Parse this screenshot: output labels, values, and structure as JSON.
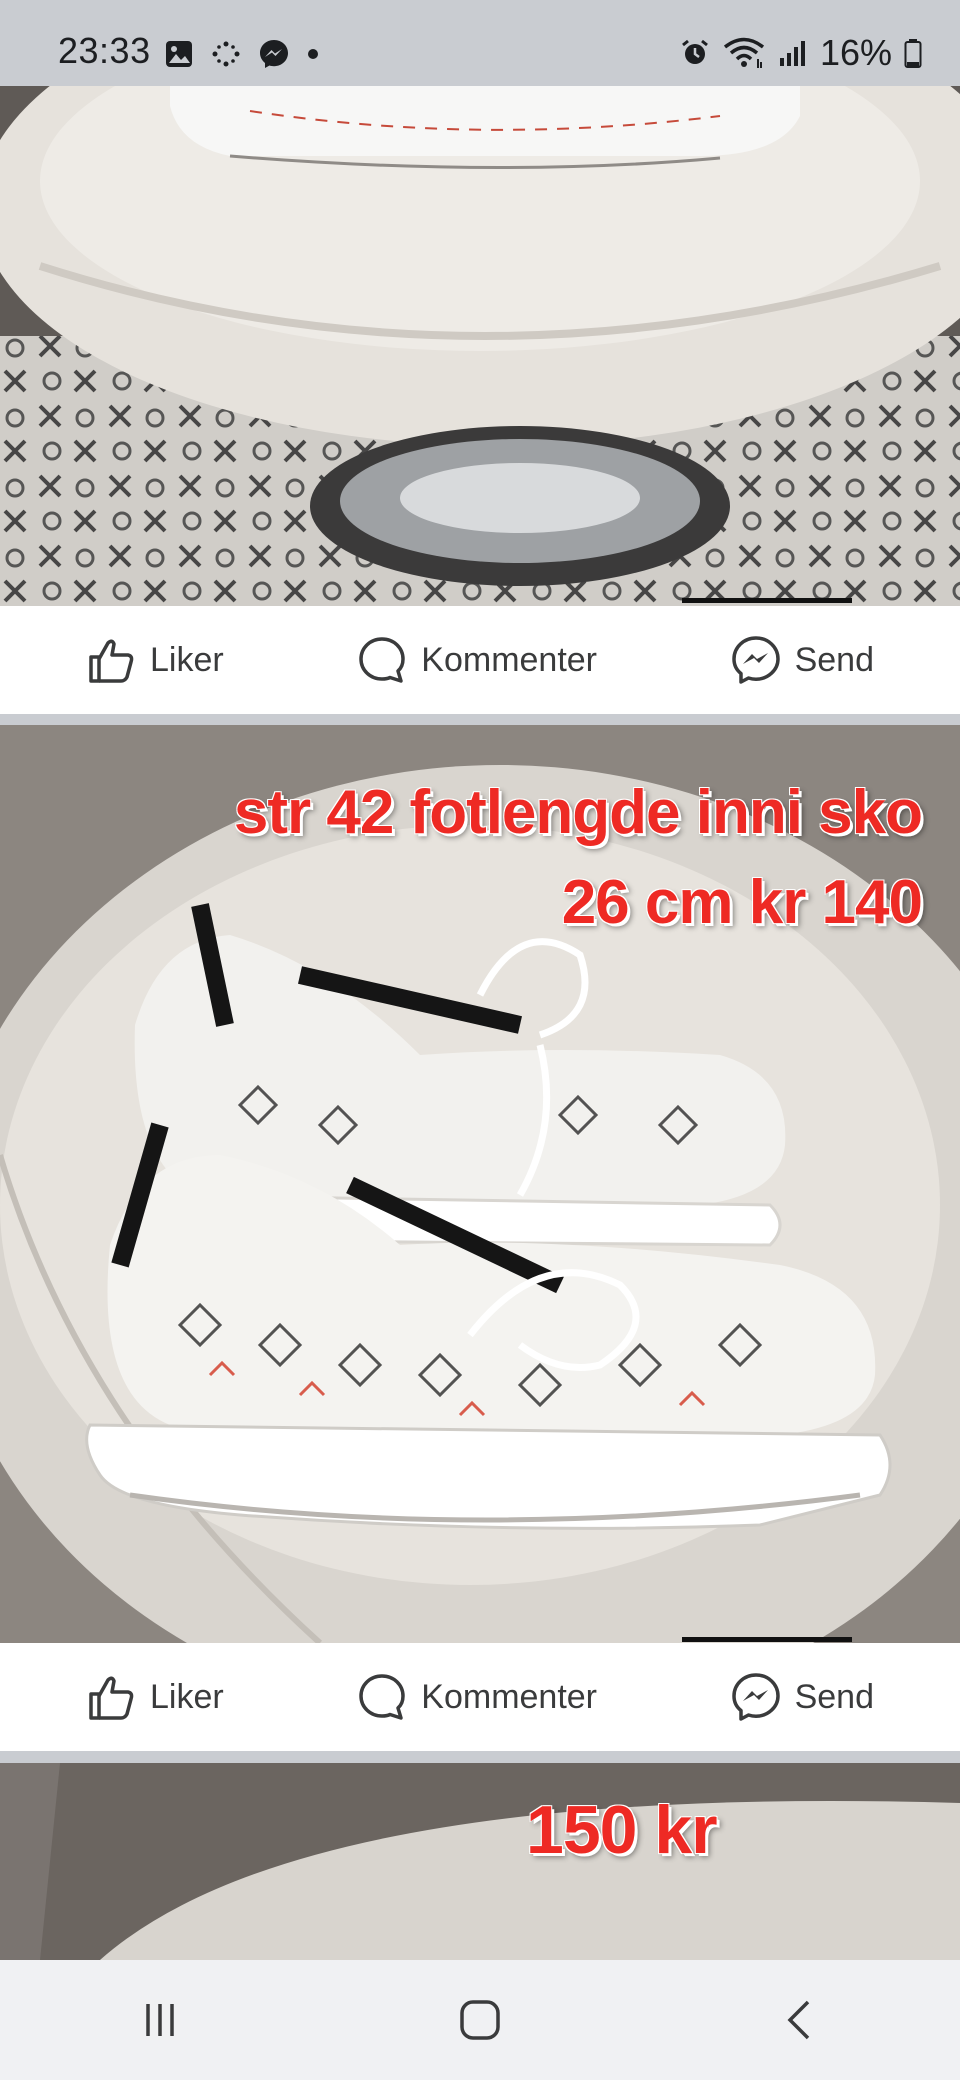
{
  "status_bar": {
    "time": "23:33",
    "battery_percent": "16%",
    "left_icons": [
      "gallery-icon",
      "sparkle-icon",
      "messenger-icon",
      "dot-icon"
    ],
    "right_icons": [
      "alarm-icon",
      "wifi-icon",
      "signal-icon",
      "battery-icon"
    ]
  },
  "posts": [
    {
      "photo_subject": "white sneaker on white leather stool",
      "overlay_text": [],
      "actions": {
        "like_label": "Liker",
        "comment_label": "Kommenter",
        "send_label": "Send"
      }
    },
    {
      "photo_subject": "pair of white knit sneakers",
      "overlay_text": [
        "str 42 fotlengde inni sko",
        "26 cm kr 140"
      ],
      "actions": {
        "like_label": "Liker",
        "comment_label": "Kommenter",
        "send_label": "Send"
      }
    },
    {
      "photo_subject": "partial next photo",
      "overlay_text": [
        "150 kr"
      ]
    }
  ],
  "nav_bar": {
    "icons": [
      "recent-apps-icon",
      "home-icon",
      "back-icon"
    ]
  },
  "colors": {
    "accent_text": "#ee2a24",
    "action_text": "#3a3b3c",
    "separator": "#c9ccd1"
  }
}
